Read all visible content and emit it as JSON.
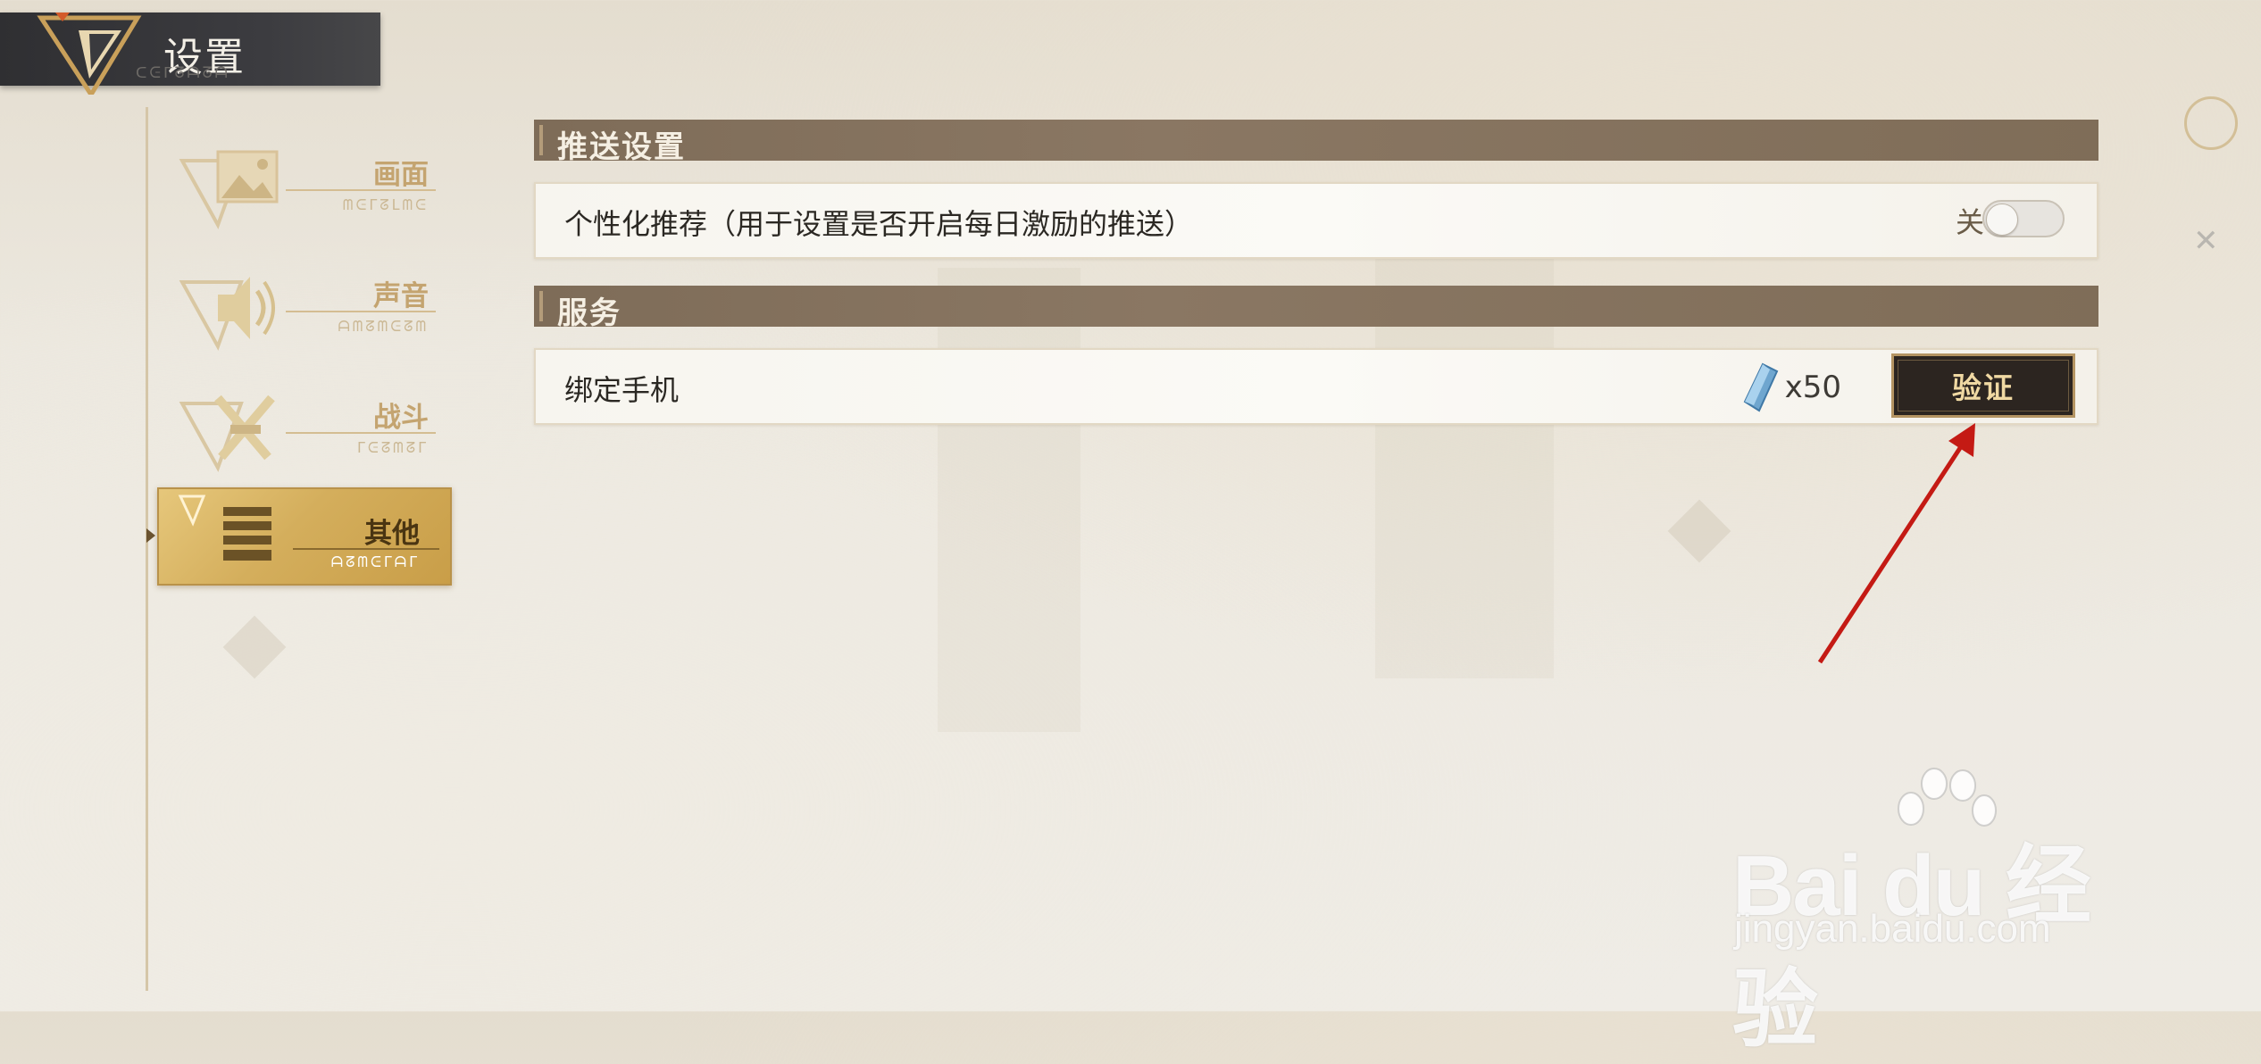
{
  "header": {
    "title": "设置",
    "subtitle": "ᑕᕮᒥᘔᗩᘔᗩ"
  },
  "sidebar": {
    "items": [
      {
        "label": "画面",
        "sub": "ᗰᕮᒥᘔᒪᗰᕮ",
        "active": false,
        "icon": "image-icon"
      },
      {
        "label": "声音",
        "sub": "ᗩᗰᘔᗰᕮᘔᗰ",
        "active": false,
        "icon": "sound-icon"
      },
      {
        "label": "战斗",
        "sub": "ᒥᕮᘔᗰᘔᒥ",
        "active": false,
        "icon": "battle-icon"
      },
      {
        "label": "其他",
        "sub": "ᗩᘔᗰᕮᒥᗩᒥ",
        "active": true,
        "icon": "list-icon"
      }
    ]
  },
  "sections": {
    "push": {
      "title": "推送设置",
      "row_label": "个性化推荐（用于设置是否开启每日激励的推送）",
      "toggle_state_label": "关",
      "toggle_on": false
    },
    "service": {
      "title": "服务",
      "row_label": "绑定手机",
      "reward_icon": "blue-crystal-icon",
      "reward_text": "x50",
      "button_label": "验证"
    }
  },
  "watermark": {
    "main": "Bai  du 经验",
    "url": "jingyan.baidu.com"
  },
  "colors": {
    "accent_gold": "#d4ae5c",
    "section_bar": "#7e6c58",
    "button_dark": "#2c2520",
    "arrow_red": "#c41a14"
  }
}
